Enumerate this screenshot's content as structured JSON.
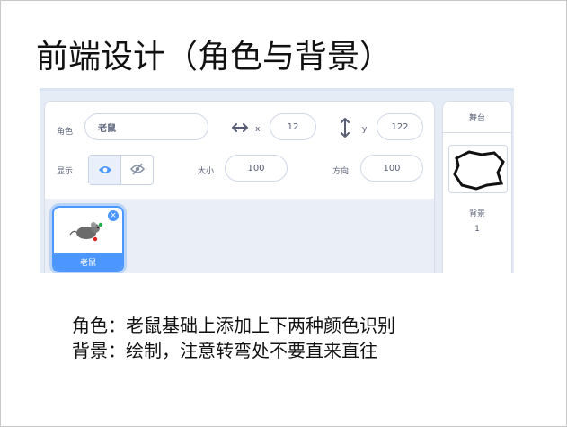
{
  "slide": {
    "title": "前端设计（角色与背景）",
    "notes": [
      "角色：老鼠基础上添加上下两种颜色识别",
      "背景：绘制，注意转弯处不要直来直往"
    ]
  },
  "sprite_info": {
    "sprite_label": "角色",
    "sprite_name": "老鼠",
    "x_icon": "horizontal-arrows-icon",
    "x_label": "x",
    "x_value": "12",
    "y_icon": "vertical-arrows-icon",
    "y_label": "y",
    "y_value": "122",
    "show_label": "显示",
    "show_icon": "eye-icon",
    "hide_icon": "eye-slash-icon",
    "size_label": "大小",
    "size_value": "100",
    "direction_label": "方向",
    "direction_value": "100"
  },
  "sprite_list": {
    "items": [
      {
        "name": "老鼠",
        "selected": true
      }
    ]
  },
  "stage": {
    "header": "舞台",
    "backdrop_label": "背景",
    "backdrop_count": "1"
  },
  "colors": {
    "accent": "#4c97ff",
    "panel_bg": "#e6ecf6",
    "text_gray": "#575e75"
  }
}
